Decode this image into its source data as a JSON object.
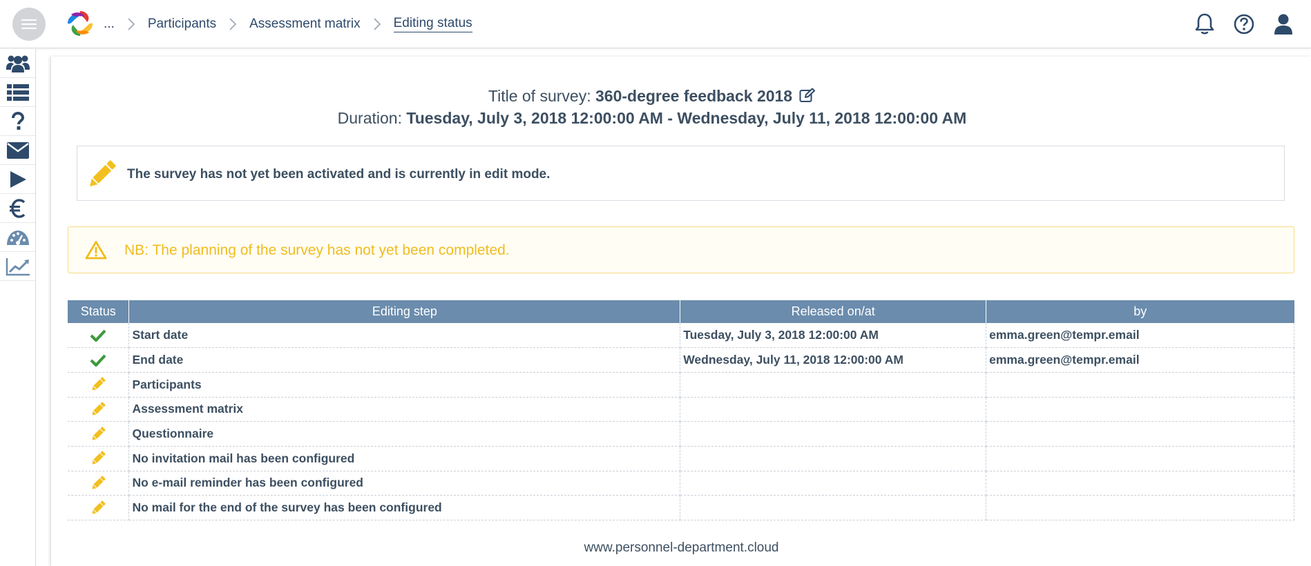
{
  "header": {
    "breadcrumb": [
      "...",
      "Participants",
      "Assessment matrix",
      "Editing status"
    ]
  },
  "sidebar": {
    "items": [
      "users-icon",
      "list-icon",
      "question-icon",
      "envelope-icon",
      "play-icon",
      "euro-icon",
      "dashboard-icon",
      "line-chart-icon"
    ]
  },
  "survey": {
    "title_label": "Title of survey: ",
    "title_value": "360-degree feedback 2018",
    "duration_label": "Duration: ",
    "duration_value": "Tuesday, July 3, 2018 12:00:00 AM - Wednesday, July 11, 2018 12:00:00 AM"
  },
  "edit_mode_message": "The survey has not yet been activated and is currently in edit mode.",
  "warning": {
    "prefix": "NB",
    "text": ": The planning of the survey has not yet been completed."
  },
  "table": {
    "headers": [
      "Status",
      "Editing step",
      "Released on/at",
      "by"
    ],
    "rows": [
      {
        "status": "done",
        "step": "Start date",
        "released": "Tuesday, July 3, 2018 12:00:00 AM",
        "by": "emma.green@tempr.email"
      },
      {
        "status": "done",
        "step": "End date",
        "released": "Wednesday, July 11, 2018 12:00:00 AM",
        "by": "emma.green@tempr.email"
      },
      {
        "status": "pending",
        "step": "Participants",
        "released": "",
        "by": ""
      },
      {
        "status": "pending",
        "step": "Assessment matrix",
        "released": "",
        "by": ""
      },
      {
        "status": "pending",
        "step": "Questionnaire",
        "released": "",
        "by": ""
      },
      {
        "status": "pending",
        "step": "No invitation mail has been configured",
        "released": "",
        "by": ""
      },
      {
        "status": "pending",
        "step": "No e-mail reminder has been configured",
        "released": "",
        "by": ""
      },
      {
        "status": "pending",
        "step": "No mail for the end of the survey has been configured",
        "released": "",
        "by": ""
      }
    ]
  },
  "footer": "www.personnel-department.cloud",
  "colors": {
    "header_bg": "#6b8cad",
    "nav_blue": "#2e4a6b",
    "check_green": "#3c9a3c",
    "pencil_yellow": "#f2c01e",
    "warning_text": "#f0bc1f"
  }
}
